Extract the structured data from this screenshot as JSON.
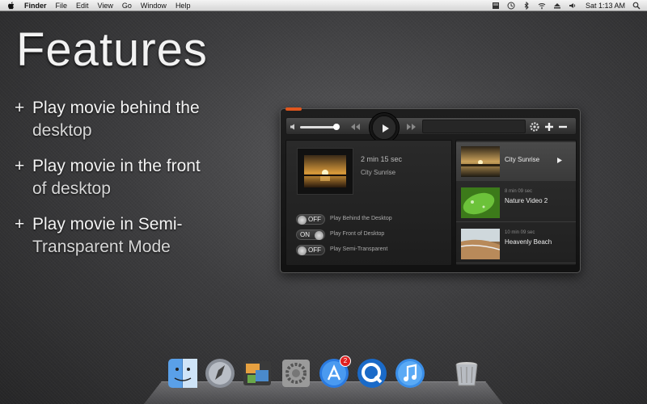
{
  "menubar": {
    "app_name": "Finder",
    "items": [
      "File",
      "Edit",
      "View",
      "Go",
      "Window",
      "Help"
    ],
    "clock": "Sat 1:13 AM"
  },
  "hero": {
    "title": "Features",
    "features": [
      {
        "plus": "+",
        "line1": "Play movie behind the",
        "line2": "desktop"
      },
      {
        "plus": "+",
        "line1": "Play movie in the front",
        "line2": "of desktop"
      },
      {
        "plus": "+",
        "line1": "Play movie in Semi-",
        "line2": "Transparent Mode"
      }
    ]
  },
  "player": {
    "now_playing": {
      "duration": "2 min 15 sec",
      "title": "City Sunrise"
    },
    "toggles": [
      {
        "state": "OFF",
        "label": "Play Behind the Desktop"
      },
      {
        "state": "ON",
        "label": "Play Front of Desktop"
      },
      {
        "state": "OFF",
        "label": "Play Semi-Transparent"
      }
    ],
    "playlist": [
      {
        "time": "",
        "name": "City Sunrise",
        "selected": true
      },
      {
        "time": "8 min 09 sec",
        "name": "Nature Video 2",
        "selected": false
      },
      {
        "time": "10 min 09 sec",
        "name": "Heavenly Beach",
        "selected": false
      }
    ],
    "accent_color": "#e0561d"
  },
  "dock": {
    "icons": [
      "finder-icon",
      "launchpad-icon",
      "iphoto-icon",
      "system-preferences-icon",
      "app-store-icon",
      "quicktime-icon",
      "itunes-icon",
      "trash-icon"
    ],
    "app_store_badge": "2"
  }
}
